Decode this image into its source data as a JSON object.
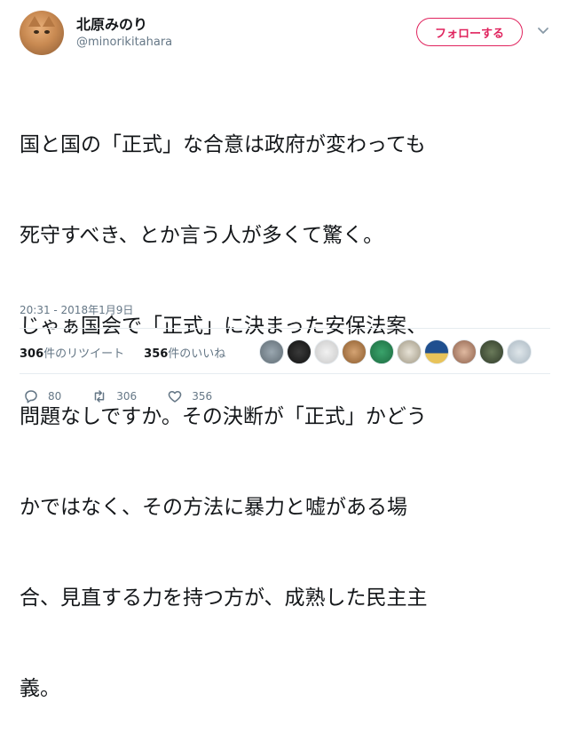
{
  "user": {
    "display_name": "北原みのり",
    "handle": "@minorikitahara"
  },
  "follow_button_label": "フォローする",
  "tweet": {
    "text_lines": [
      "国と国の「正式」な合意は政府が変わっても",
      "死守すべき、とか言う人が多くて驚く。",
      "じゃぁ国会で「正式」に決まった安保法案、",
      "問題なしですか。その決断が「正式」かどう",
      "かではなく、その方法に暴力と嘘がある場",
      "合、見直する力を持つ方が、成熟した民主主",
      "義。"
    ],
    "timestamp": "20:31 - 2018年1月9日"
  },
  "stats": {
    "retweets_count": "306",
    "retweets_label": "件のリツイート",
    "likes_count": "356",
    "likes_label": "件のいいね"
  },
  "liker_avatars": [
    "avatar-1",
    "avatar-2",
    "avatar-3",
    "avatar-4",
    "avatar-5",
    "avatar-6",
    "avatar-7",
    "avatar-8",
    "avatar-9",
    "avatar-10"
  ],
  "actions": {
    "reply_count": "80",
    "retweet_count": "306",
    "like_count": "356"
  },
  "colors": {
    "accent": "#e0245e",
    "muted": "#657786",
    "text": "#14171a"
  }
}
